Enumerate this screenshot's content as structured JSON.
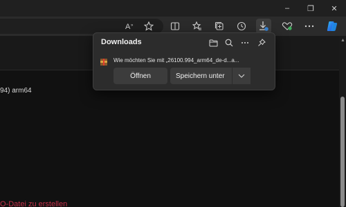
{
  "window": {
    "minimize_label": "–",
    "maximize_label": "❐",
    "close_label": "✕"
  },
  "page": {
    "line_text": "94) arm64",
    "red_text": "O-Datei zu erstellen"
  },
  "downloads": {
    "title": "Downloads",
    "item_text": "Wie möchten Sie mit „26100.994_arm64_de-d...a...",
    "open_button": "Öffnen",
    "save_button": "Speichern unter",
    "dropdown_arrow": "⌄"
  },
  "toolbar_icons": [
    "read-aloud-icon",
    "favorite-star-icon",
    "split-screen-icon",
    "favorites-icon",
    "collections-icon",
    "history-icon",
    "downloads-icon",
    "browser-essentials-icon",
    "more-icon",
    "copilot-icon"
  ],
  "colors": {
    "accent": "#c4314b",
    "panel": "#2c2c2c"
  }
}
